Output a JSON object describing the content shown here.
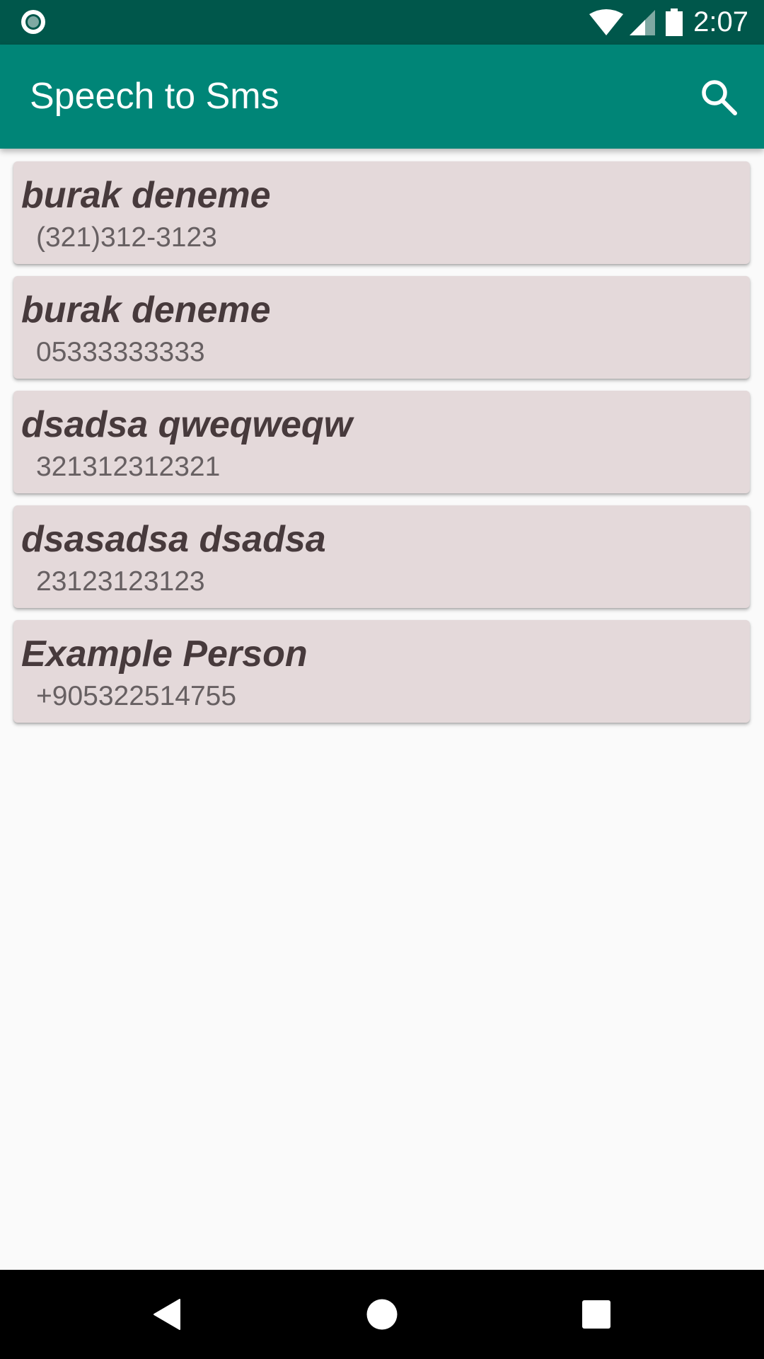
{
  "status_bar": {
    "time": "2:07",
    "icons": [
      "notification-dot-icon",
      "wifi-icon",
      "cell-signal-icon",
      "battery-icon"
    ]
  },
  "app_bar": {
    "title": "Speech to Sms",
    "search_icon": "search-icon"
  },
  "contacts": [
    {
      "name": "burak deneme",
      "number": "(321)312-3123"
    },
    {
      "name": "burak deneme",
      "number": "05333333333"
    },
    {
      "name": "dsadsa qweqweqw",
      "number": "321312312321"
    },
    {
      "name": "dsasadsa dsadsa",
      "number": "23123123123"
    },
    {
      "name": "Example Person",
      "number": "+905322514755"
    }
  ],
  "nav_bar": {
    "icons": [
      "back-icon",
      "home-icon",
      "recents-icon"
    ]
  },
  "colors": {
    "status_bar": "#00574b",
    "app_bar": "#008577",
    "card_background": "#e4d9da",
    "name_text": "#473a3c",
    "number_text": "#676062",
    "page_background": "#fafafa"
  }
}
